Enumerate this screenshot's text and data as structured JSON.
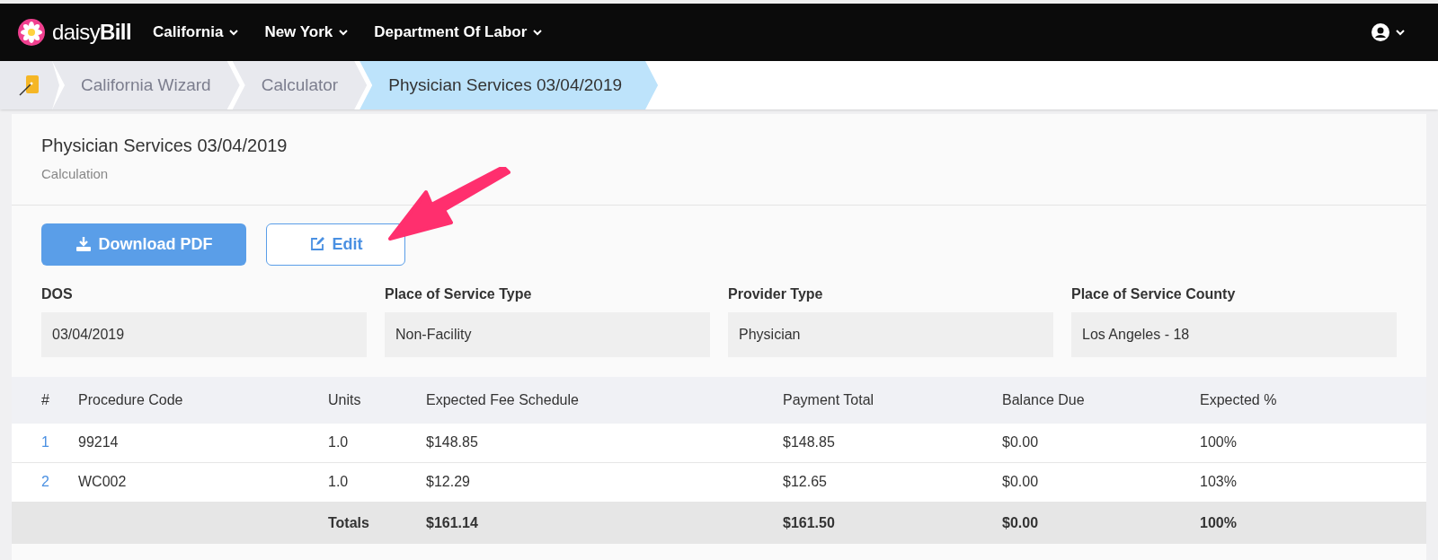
{
  "navbar": {
    "logo_text": "daisy",
    "logo_bold": "Bill",
    "menus": [
      {
        "label": "California"
      },
      {
        "label": "New York"
      },
      {
        "label": "Department Of Labor"
      }
    ]
  },
  "breadcrumbs": [
    {
      "label": "California Wizard",
      "selected": false
    },
    {
      "label": "Calculator",
      "selected": false
    },
    {
      "label": "Physician Services 03/04/2019",
      "selected": true
    }
  ],
  "header": {
    "title": "Physician Services 03/04/2019",
    "subtitle": "Calculation"
  },
  "buttons": [
    {
      "kind": "primary",
      "label": "Download PDF"
    },
    {
      "kind": "outline",
      "label": "Edit"
    }
  ],
  "fields": [
    {
      "label": "DOS",
      "value": "03/04/2019"
    },
    {
      "label": "Place of Service Type",
      "value": "Non-Facility"
    },
    {
      "label": "Provider Type",
      "value": "Physician"
    },
    {
      "label": "Place of Service County",
      "value": "Los Angeles - 18"
    }
  ],
  "table": {
    "columns": [
      "#",
      "Procedure Code",
      "Units",
      "Expected Fee Schedule",
      "Payment Total",
      "Balance Due",
      "Expected %"
    ],
    "rows": [
      [
        "1",
        "99214",
        "1.0",
        "$148.85",
        "$148.85",
        "$0.00",
        "100%"
      ],
      [
        "2",
        "WC002",
        "1.0",
        "$12.29",
        "$12.65",
        "$0.00",
        "103%"
      ]
    ],
    "totals": {
      "label": "Totals",
      "values": [
        "$161.14",
        "$161.50",
        "$0.00",
        "100%"
      ]
    }
  }
}
